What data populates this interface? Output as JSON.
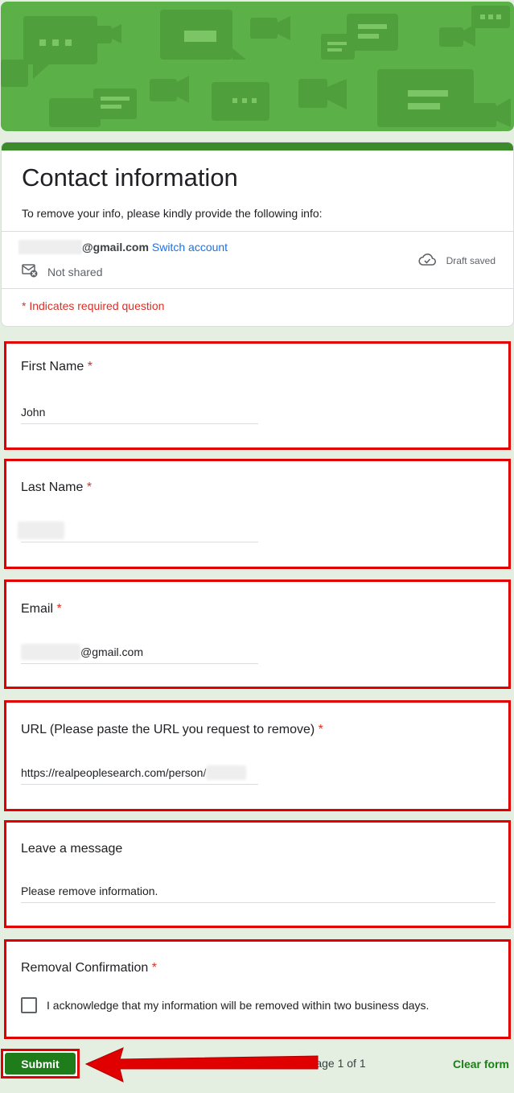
{
  "colors": {
    "banner": "#5cb048",
    "accent": "#3b8a2c",
    "required": "#d93025",
    "link": "#1a73e8",
    "submit": "#1e7c1a",
    "highlight": "#e00000"
  },
  "form": {
    "title": "Contact information",
    "description": "To remove your info, please kindly provide the following info:",
    "account_suffix": "@gmail.com",
    "switch_account": "Switch account",
    "not_shared": "Not shared",
    "draft_status": "Draft saved",
    "required_note": "* Indicates required question"
  },
  "questions": [
    {
      "label": "First Name",
      "required": "*",
      "value": "John",
      "icon": ""
    },
    {
      "label": "Last Name",
      "required": "*",
      "value": ""
    },
    {
      "label": "Email",
      "required": "*",
      "value_suffix": "@gmail.com"
    },
    {
      "label": "URL (Please paste the URL you request to remove)",
      "required": "*",
      "value": "https://realpeoplesearch.com/person/"
    },
    {
      "label": "Leave a message",
      "value": "Please remove information."
    },
    {
      "label": "Removal Confirmation",
      "required": "*",
      "checkbox_label": "I acknowledge that my information will be removed within two business days."
    }
  ],
  "footer": {
    "submit": "Submit",
    "page_info": "Page 1 of 1",
    "clear_form": "Clear form"
  },
  "icons": {
    "mail": "mail-not-shared-icon",
    "cloud": "cloud-check-icon",
    "arrow": "red-arrow-annotation"
  }
}
